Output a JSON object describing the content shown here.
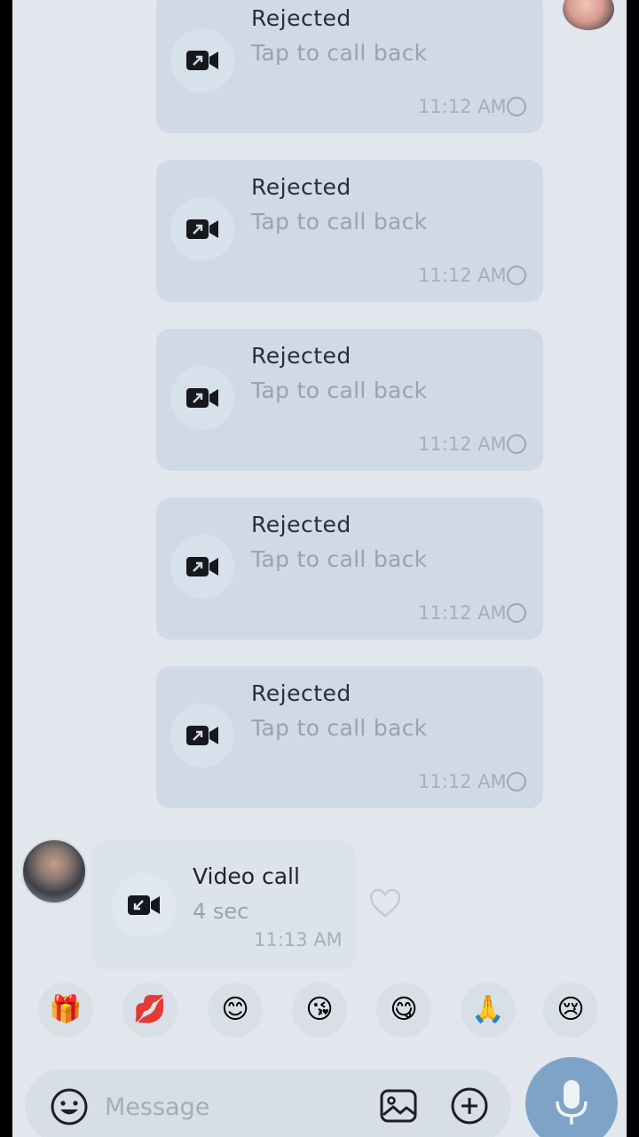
{
  "chat": {
    "outgoing_calls": [
      {
        "title": "Rejected",
        "subtitle": "Tap to call back",
        "time": "11:12 AM"
      },
      {
        "title": "Rejected",
        "subtitle": "Tap to call back",
        "time": "11:12 AM"
      },
      {
        "title": "Rejected",
        "subtitle": "Tap to call back",
        "time": "11:12 AM"
      },
      {
        "title": "Rejected",
        "subtitle": "Tap to call back",
        "time": "11:12 AM"
      },
      {
        "title": "Rejected",
        "subtitle": "Tap to call back",
        "time": "11:12 AM"
      }
    ],
    "incoming_call": {
      "title": "Video call",
      "duration": "4 sec",
      "time": "11:13 AM"
    }
  },
  "reactions": [
    {
      "icon": "gift-box-icon",
      "glyph": "🎁"
    },
    {
      "icon": "lips-icon",
      "glyph": "💋"
    },
    {
      "icon": "smiling-face-icon",
      "glyph": "😊"
    },
    {
      "icon": "kissing-face-icon",
      "glyph": "😘"
    },
    {
      "icon": "yum-face-icon",
      "glyph": "😋"
    },
    {
      "icon": "folded-hands-icon",
      "glyph": "🙏"
    },
    {
      "icon": "crying-face-icon",
      "glyph": "😢"
    }
  ],
  "composer": {
    "placeholder": "Message"
  },
  "colors": {
    "accent": "#7fa3c6",
    "outgoing_bubble": "#cfdae6",
    "incoming_bubble": "#dde3ea",
    "background": "#e2e7ee"
  }
}
